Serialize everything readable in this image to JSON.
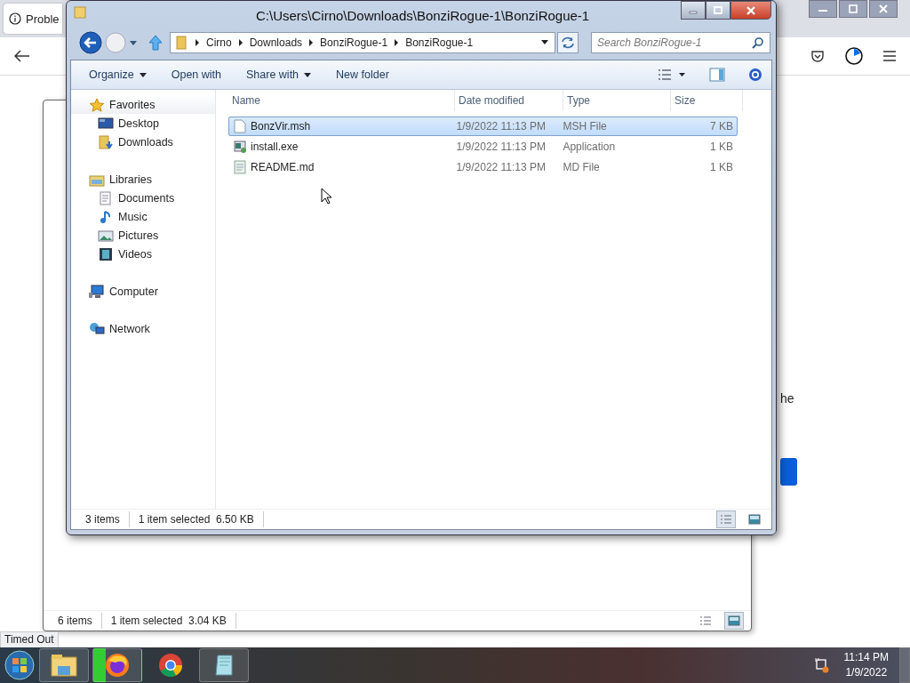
{
  "browser": {
    "tab_title": "Proble",
    "page_fragment": "he"
  },
  "background_explorer": {
    "status_bar": {
      "item_count": "6 items",
      "selection": "1 item selected  3.04 KB"
    },
    "view_buttons": [
      {
        "kind": "details",
        "selected": false
      },
      {
        "kind": "preview",
        "selected": true
      }
    ]
  },
  "browser_status": "Timed Out",
  "explorer": {
    "title": "C:\\Users\\Cirno\\Downloads\\BonziRogue-1\\BonziRogue-1",
    "breadcrumb": [
      "Cirno",
      "Downloads",
      "BonziRogue-1",
      "BonziRogue-1"
    ],
    "search": {
      "placeholder": "Search BonziRogue-1"
    },
    "toolbar": [
      {
        "label": "Organize",
        "dropdown": true
      },
      {
        "label": "Open with",
        "dropdown": false
      },
      {
        "label": "Share with",
        "dropdown": true
      },
      {
        "label": "New folder",
        "dropdown": false
      }
    ],
    "nav_pane": [
      {
        "label": "Favorites",
        "kind": "star",
        "selected": true,
        "children": [
          {
            "label": "Desktop",
            "kind": "desktop",
            "selected": false
          },
          {
            "label": "Downloads",
            "kind": "downloads",
            "selected": false
          }
        ]
      },
      {
        "label": "Libraries",
        "kind": "library",
        "selected": false,
        "children": [
          {
            "label": "Documents",
            "kind": "document",
            "selected": false
          },
          {
            "label": "Music",
            "kind": "music",
            "selected": false
          },
          {
            "label": "Pictures",
            "kind": "pictures",
            "selected": false
          },
          {
            "label": "Videos",
            "kind": "videos",
            "selected": false
          }
        ]
      },
      {
        "label": "Computer",
        "kind": "computer",
        "selected": false
      },
      {
        "label": "Network",
        "kind": "network",
        "selected": false
      }
    ],
    "columns": [
      "Name",
      "Date modified",
      "Type",
      "Size"
    ],
    "files": [
      {
        "name": "BonzVir.msh",
        "date": "1/9/2022 11:13 PM",
        "type": "MSH File",
        "size": "7 KB",
        "kind": "blank",
        "selected": true
      },
      {
        "name": "install.exe",
        "date": "1/9/2022 11:13 PM",
        "type": "Application",
        "size": "1 KB",
        "kind": "exe",
        "selected": false
      },
      {
        "name": "README.md",
        "date": "1/9/2022 11:13 PM",
        "type": "MD File",
        "size": "1 KB",
        "kind": "text",
        "selected": false
      }
    ],
    "status_bar": {
      "item_count": "3 items",
      "selection": "1 item selected  6.50 KB"
    },
    "view_buttons": [
      {
        "kind": "details",
        "selected": true
      },
      {
        "kind": "preview",
        "selected": false
      }
    ]
  },
  "taskbar": {
    "apps": [
      {
        "kind": "explorer"
      },
      {
        "kind": "firefox"
      },
      {
        "kind": "chrome"
      },
      {
        "kind": "notepad"
      }
    ],
    "clock": {
      "time": "11:14 PM",
      "date": "1/9/2022"
    }
  }
}
